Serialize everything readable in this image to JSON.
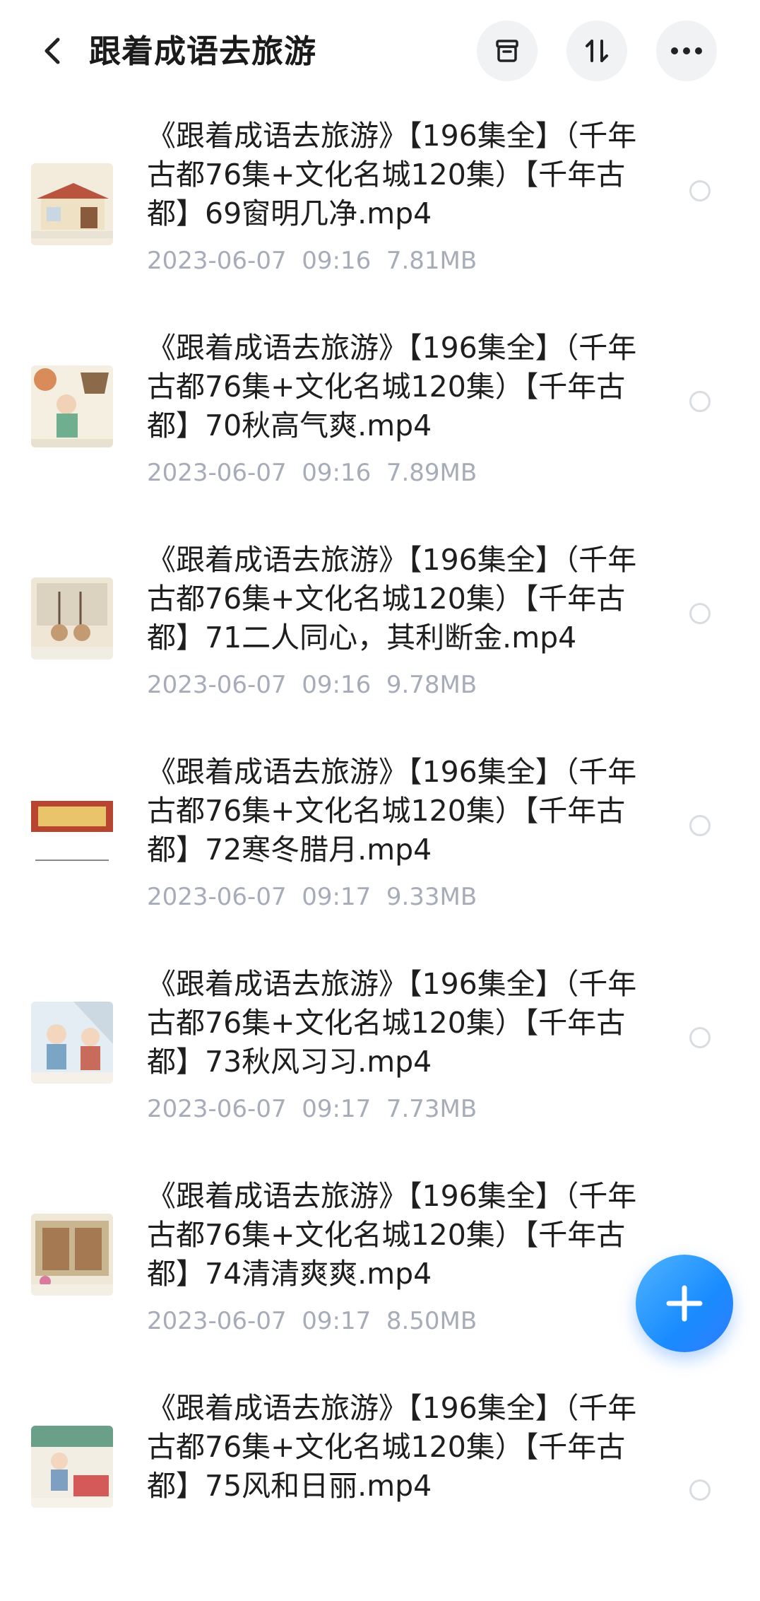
{
  "header": {
    "title": "跟着成语去旅游",
    "back_icon": "chevron-left-icon",
    "archive_icon": "archive-box-icon",
    "sort_icon": "sort-arrows-icon",
    "more_icon": "more-dots-icon"
  },
  "files": [
    {
      "name": "《跟着成语去旅游》【196集全】（千年古都76集+文化名城120集）【千年古都】69窗明几净.mp4",
      "date": "2023-06-07",
      "time": "09:16",
      "size": "7.81MB",
      "thumb_icon": "video-thumbnail-icon"
    },
    {
      "name": "《跟着成语去旅游》【196集全】（千年古都76集+文化名城120集）【千年古都】70秋高气爽.mp4",
      "date": "2023-06-07",
      "time": "09:16",
      "size": "7.89MB",
      "thumb_icon": "video-thumbnail-icon"
    },
    {
      "name": "《跟着成语去旅游》【196集全】（千年古都76集+文化名城120集）【千年古都】71二人同心，其利断金.mp4",
      "date": "2023-06-07",
      "time": "09:16",
      "size": "9.78MB",
      "thumb_icon": "video-thumbnail-icon"
    },
    {
      "name": "《跟着成语去旅游》【196集全】（千年古都76集+文化名城120集）【千年古都】72寒冬腊月.mp4",
      "date": "2023-06-07",
      "time": "09:17",
      "size": "9.33MB",
      "thumb_icon": "video-thumbnail-icon"
    },
    {
      "name": "《跟着成语去旅游》【196集全】（千年古都76集+文化名城120集）【千年古都】73秋风习习.mp4",
      "date": "2023-06-07",
      "time": "09:17",
      "size": "7.73MB",
      "thumb_icon": "video-thumbnail-icon"
    },
    {
      "name": "《跟着成语去旅游》【196集全】（千年古都76集+文化名城120集）【千年古都】74清清爽爽.mp4",
      "date": "2023-06-07",
      "time": "09:17",
      "size": "8.50MB",
      "thumb_icon": "video-thumbnail-icon"
    },
    {
      "name": "《跟着成语去旅游》【196集全】（千年古都76集+文化名城120集）【千年古都】75风和日丽.mp4",
      "date": "",
      "time": "",
      "size": "",
      "thumb_icon": "video-thumbnail-icon"
    }
  ],
  "fab": {
    "icon": "plus-icon"
  },
  "colors": {
    "accent": "#1a8cff",
    "meta_text": "#a6acb8",
    "header_button_bg": "#f1f2f4"
  }
}
